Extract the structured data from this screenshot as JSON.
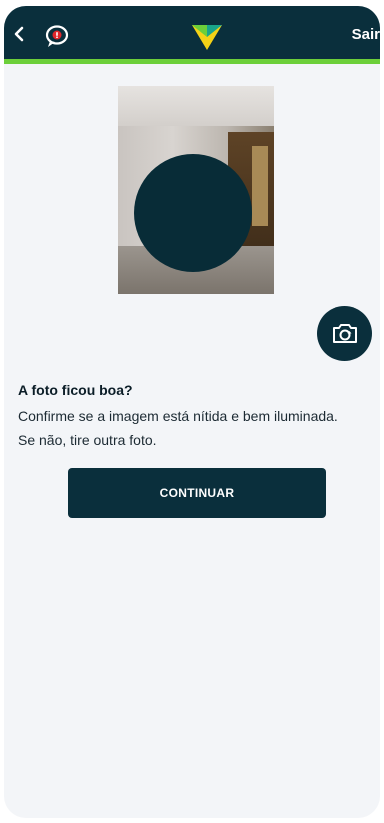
{
  "header": {
    "back_icon": "chevron-left-icon",
    "chat_icon": "chat-alert-icon",
    "logo_icon": "brand-logo-icon",
    "exit_label": "Sair",
    "background": "#0a2f3c",
    "accent": "#6ccf3a"
  },
  "photo": {
    "face_mask_color": "#082c37"
  },
  "camera_button": {
    "icon": "camera-rotate-icon"
  },
  "content": {
    "question": "A foto ficou boa?",
    "line1": "Confirme se a imagem está nítida e bem iluminada.",
    "line2": "Se não, tire outra foto."
  },
  "actions": {
    "continue_label": "CONTINUAR"
  }
}
